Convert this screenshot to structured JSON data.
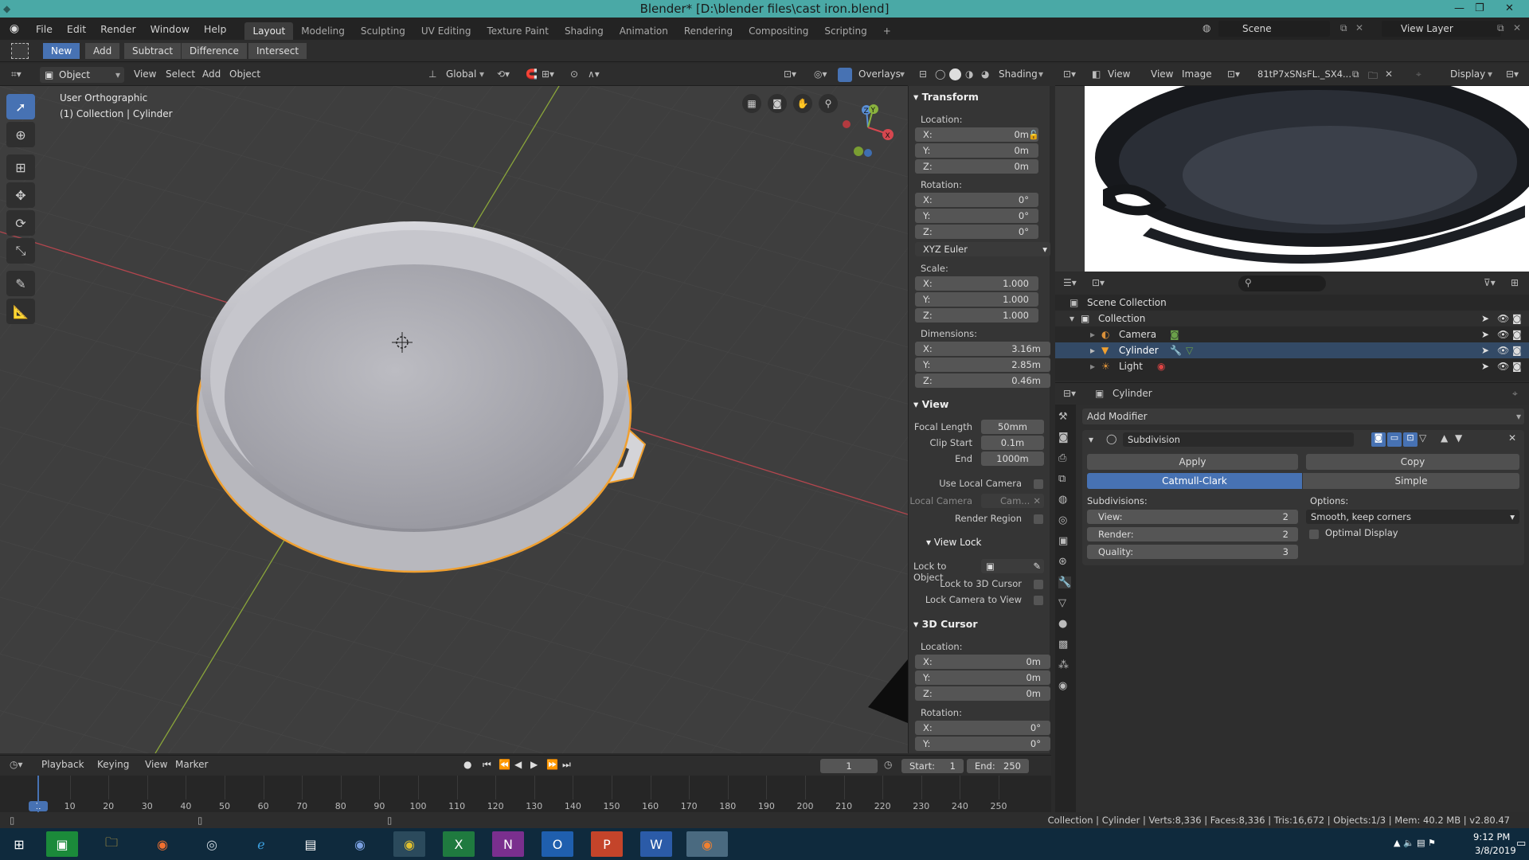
{
  "window": {
    "title": "Blender* [D:\\blender files\\cast iron.blend]"
  },
  "menus": [
    "File",
    "Edit",
    "Render",
    "Window",
    "Help"
  ],
  "workspaces": [
    "Layout",
    "Modeling",
    "Sculpting",
    "UV Editing",
    "Texture Paint",
    "Shading",
    "Animation",
    "Rendering",
    "Compositing",
    "Scripting"
  ],
  "active_workspace": "Layout",
  "scene": {
    "label": "Scene",
    "view_layer": "View Layer"
  },
  "tool_header": {
    "buttons": [
      "New",
      "Add",
      "Subtract",
      "Difference",
      "Intersect"
    ]
  },
  "viewport_header": {
    "mode": "Object Mode",
    "menus": [
      "View",
      "Select",
      "Add",
      "Object"
    ],
    "orientation": "Global",
    "overlays": "Overlays",
    "shading": "Shading"
  },
  "viewport": {
    "view_name": "User Orthographic",
    "collection_info": "(1) Collection | Cylinder"
  },
  "gizmo": {
    "x": "X",
    "y": "Y",
    "z": "Z"
  },
  "npanel": {
    "transform_title": "Transform",
    "location_label": "Location:",
    "location": [
      {
        "k": "X:",
        "v": "0m"
      },
      {
        "k": "Y:",
        "v": "0m"
      },
      {
        "k": "Z:",
        "v": "0m"
      }
    ],
    "rotation_label": "Rotation:",
    "rotation": [
      {
        "k": "X:",
        "v": "0°"
      },
      {
        "k": "Y:",
        "v": "0°"
      },
      {
        "k": "Z:",
        "v": "0°"
      }
    ],
    "rotation_mode": "XYZ Euler",
    "scale_label": "Scale:",
    "scale": [
      {
        "k": "X:",
        "v": "1.000"
      },
      {
        "k": "Y:",
        "v": "1.000"
      },
      {
        "k": "Z:",
        "v": "1.000"
      }
    ],
    "dimensions_label": "Dimensions:",
    "dimensions": [
      {
        "k": "X:",
        "v": "3.16m"
      },
      {
        "k": "Y:",
        "v": "2.85m"
      },
      {
        "k": "Z:",
        "v": "0.46m"
      }
    ],
    "view_title": "View",
    "focal_length_label": "Focal Length",
    "focal_length": "50mm",
    "clip_start_label": "Clip Start",
    "clip_start": "0.1m",
    "clip_end_label": "End",
    "clip_end": "1000m",
    "use_local_camera": "Use Local Camera",
    "local_camera_label": "Local Camera",
    "local_camera_value": "Cam...",
    "render_region": "Render Region",
    "view_lock_title": "View Lock",
    "lock_to_object": "Lock to Object",
    "lock_to_cursor": "Lock to 3D Cursor",
    "lock_camera": "Lock Camera to View",
    "cursor_title": "3D Cursor",
    "cursor_location_label": "Location:",
    "cursor_location": [
      {
        "k": "X:",
        "v": "0m"
      },
      {
        "k": "Y:",
        "v": "0m"
      },
      {
        "k": "Z:",
        "v": "0m"
      }
    ],
    "cursor_rotation_label": "Rotation:",
    "cursor_rotation": [
      {
        "k": "X:",
        "v": "0°"
      },
      {
        "k": "Y:",
        "v": "0°"
      }
    ]
  },
  "image_editor": {
    "menus": [
      "View",
      "View",
      "Image"
    ],
    "image_name": "81tP7xSNsFL._SX4...",
    "display": "Display"
  },
  "outliner": {
    "scene_collection": "Scene Collection",
    "collection": "Collection",
    "items": [
      "Camera",
      "Cylinder",
      "Light"
    ]
  },
  "properties": {
    "object_name": "Cylinder",
    "add_modifier": "Add Modifier",
    "modifier_name": "Subdivision",
    "apply": "Apply",
    "copy": "Copy",
    "catmull": "Catmull-Clark",
    "simple": "Simple",
    "subdivisions_label": "Subdivisions:",
    "options_label": "Options:",
    "view_label": "View:",
    "view_value": "2",
    "render_label": "Render:",
    "render_value": "2",
    "quality_label": "Quality:",
    "quality_value": "3",
    "uv_option": "Smooth, keep corners",
    "optimal_display": "Optimal Display"
  },
  "timeline": {
    "menus": [
      "Playback",
      "Keying",
      "View",
      "Marker"
    ],
    "current_frame": "1",
    "start_label": "Start:",
    "start": "1",
    "end_label": "End:",
    "end": "250",
    "ticks": [
      "1",
      "10",
      "20",
      "30",
      "40",
      "50",
      "60",
      "70",
      "80",
      "90",
      "100",
      "110",
      "120",
      "130",
      "140",
      "150",
      "160",
      "170",
      "180",
      "190",
      "200",
      "210",
      "220",
      "230",
      "240",
      "250"
    ]
  },
  "statusbar": {
    "text": "Collection | Cylinder | Verts:8,336 | Faces:8,336 | Tris:16,672 | Objects:1/3 | Mem: 40.2 MB | v2.80.47"
  },
  "taskbar": {
    "time": "9:12 PM",
    "date": "3/8/2019"
  },
  "colors": {
    "accent": "#4772b3",
    "titlebar": "#4aa9a6",
    "selected_outline": "#f0a030"
  }
}
